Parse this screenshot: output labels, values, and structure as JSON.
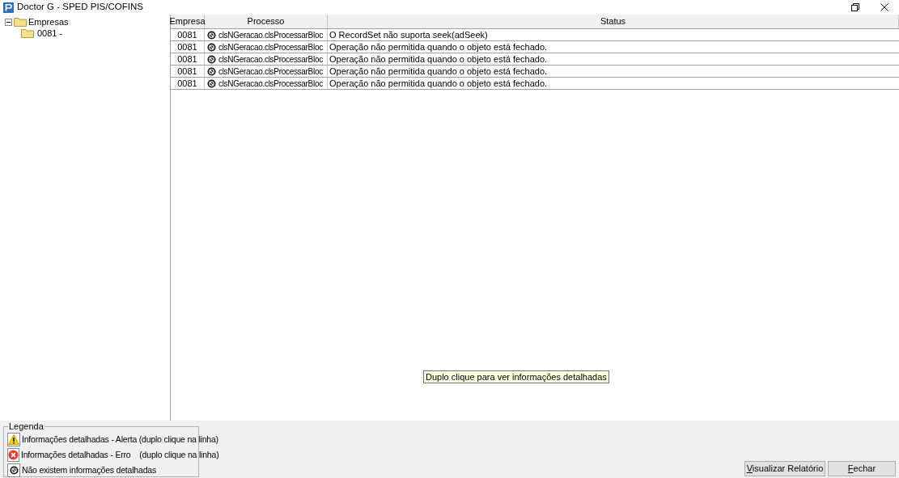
{
  "window": {
    "title": "Doctor G - SPED PIS/COFINS"
  },
  "tree": [
    {
      "label": "Empresas",
      "expanded": true,
      "children": [
        {
          "label": "0081 -"
        }
      ]
    }
  ],
  "table": {
    "columns": [
      "Empresa",
      "Processo",
      "Status"
    ],
    "rows": [
      {
        "empresa": "0081",
        "kind": "none",
        "processo": "clsNGeracao.clsProcessarBloc",
        "status": "O RecordSet não suporta seek(adSeek)"
      },
      {
        "empresa": "0081",
        "kind": "none",
        "processo": "clsNGeracao.clsProcessarBloc",
        "status": "Operação não permitida quando o objeto está fechado."
      },
      {
        "empresa": "0081",
        "kind": "none",
        "processo": "clsNGeracao.clsProcessarBloc",
        "status": "Operação não permitida quando o objeto está fechado."
      },
      {
        "empresa": "0081",
        "kind": "none",
        "processo": "clsNGeracao.clsProcessarBloc",
        "status": "Operação não permitida quando o objeto está fechado."
      },
      {
        "empresa": "0081",
        "kind": "none",
        "processo": "clsNGeracao.clsProcessarBloc",
        "status": "Operação não permitida quando o objeto está fechado."
      }
    ]
  },
  "tooltip": "Duplo clique para ver informações detalhadas",
  "legend": {
    "title": "Legenda",
    "items": [
      {
        "kind": "alert",
        "label": "Informações detalhadas - Alerta (duplo clique na linha)"
      },
      {
        "kind": "error",
        "label": "Informações detalhadas - Erro    (duplo clique na linha)"
      },
      {
        "kind": "none",
        "label": "Não existem informações detalhadas"
      }
    ]
  },
  "buttons": [
    {
      "label": "Visualizar Relatório",
      "underline_first": true
    },
    {
      "label": "Fechar",
      "underline_first": true
    }
  ]
}
